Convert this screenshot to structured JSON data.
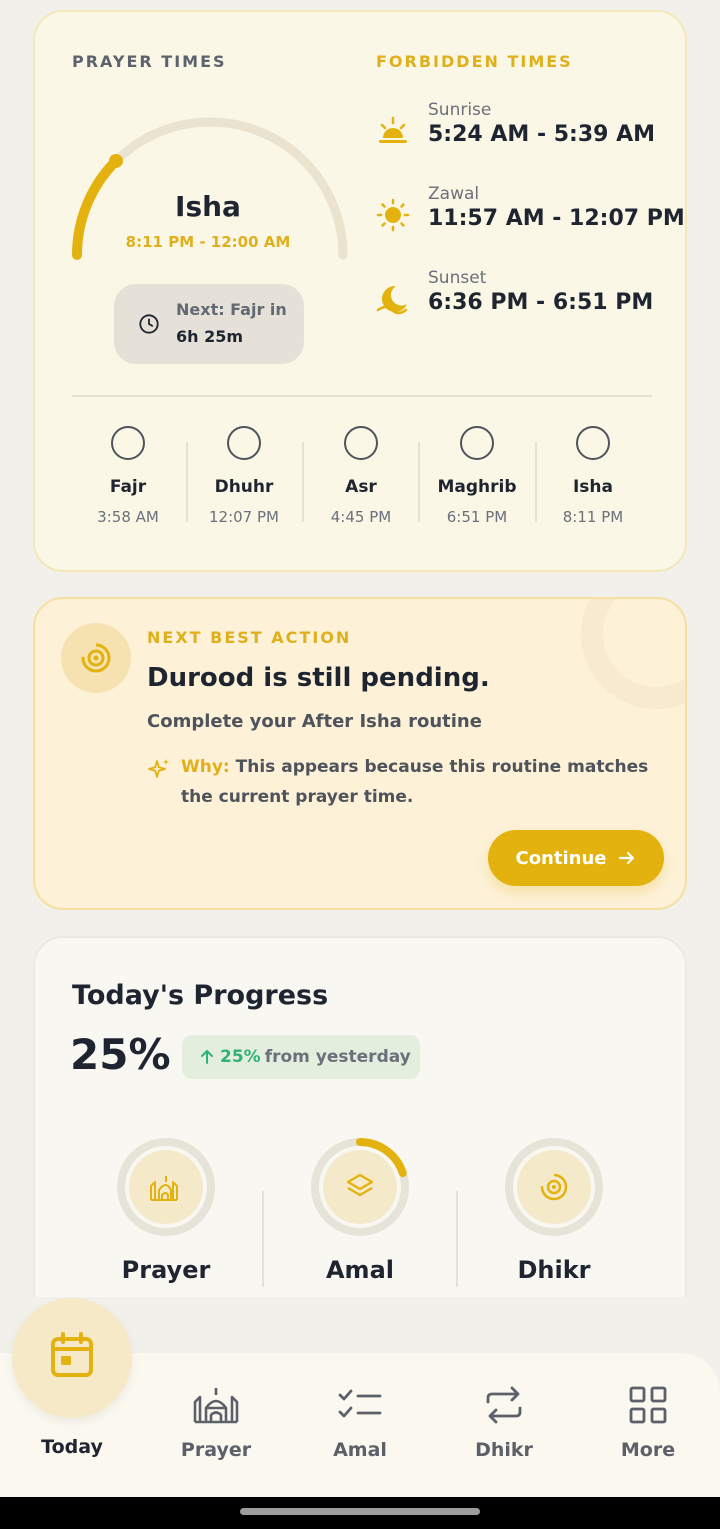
{
  "prayer_card": {
    "section_label": "PRAYER TIMES",
    "current": {
      "name": "Isha",
      "range": "8:11 PM - 12:00 AM"
    },
    "next": {
      "line1": "Next: Fajr in",
      "line2": "6h 25m"
    },
    "progress_fraction": 0.25,
    "forbidden_label": "FORBIDDEN TIMES",
    "forbidden": [
      {
        "name": "Sunrise",
        "time": "5:24 AM - 5:39 AM",
        "icon": "sunrise-icon"
      },
      {
        "name": "Zawal",
        "time": "11:57 AM - 12:07 PM",
        "icon": "sun-icon"
      },
      {
        "name": "Sunset",
        "time": "6:36 PM - 6:51 PM",
        "icon": "moon-icon"
      }
    ],
    "prayers": [
      {
        "name": "Fajr",
        "time": "3:58 AM"
      },
      {
        "name": "Dhuhr",
        "time": "12:07 PM"
      },
      {
        "name": "Asr",
        "time": "4:45 PM"
      },
      {
        "name": "Maghrib",
        "time": "6:51 PM"
      },
      {
        "name": "Isha",
        "time": "8:11 PM"
      }
    ]
  },
  "action_card": {
    "label": "NEXT BEST ACTION",
    "title": "Durood is still pending.",
    "subtitle": "Complete your After Isha routine",
    "why_key": "Why:",
    "why_line1": "This appears because this routine matches",
    "why_line2": "the current prayer time.",
    "button": "Continue"
  },
  "progress_card": {
    "title": "Today's Progress",
    "percent": "25%",
    "delta_value": "25%",
    "delta_text": "from yesterday",
    "items": [
      {
        "label": "Prayer",
        "fraction": 0
      },
      {
        "label": "Amal",
        "fraction": 0.2
      },
      {
        "label": "Dhikr",
        "fraction": 0
      }
    ]
  },
  "nav": {
    "items": [
      {
        "label": "Today"
      },
      {
        "label": "Prayer"
      },
      {
        "label": "Amal"
      },
      {
        "label": "Dhikr"
      },
      {
        "label": "More"
      }
    ]
  },
  "colors": {
    "accent": "#e3b20e",
    "text": "#1f2530",
    "muted": "#6b707a",
    "up": "#2fb374"
  }
}
